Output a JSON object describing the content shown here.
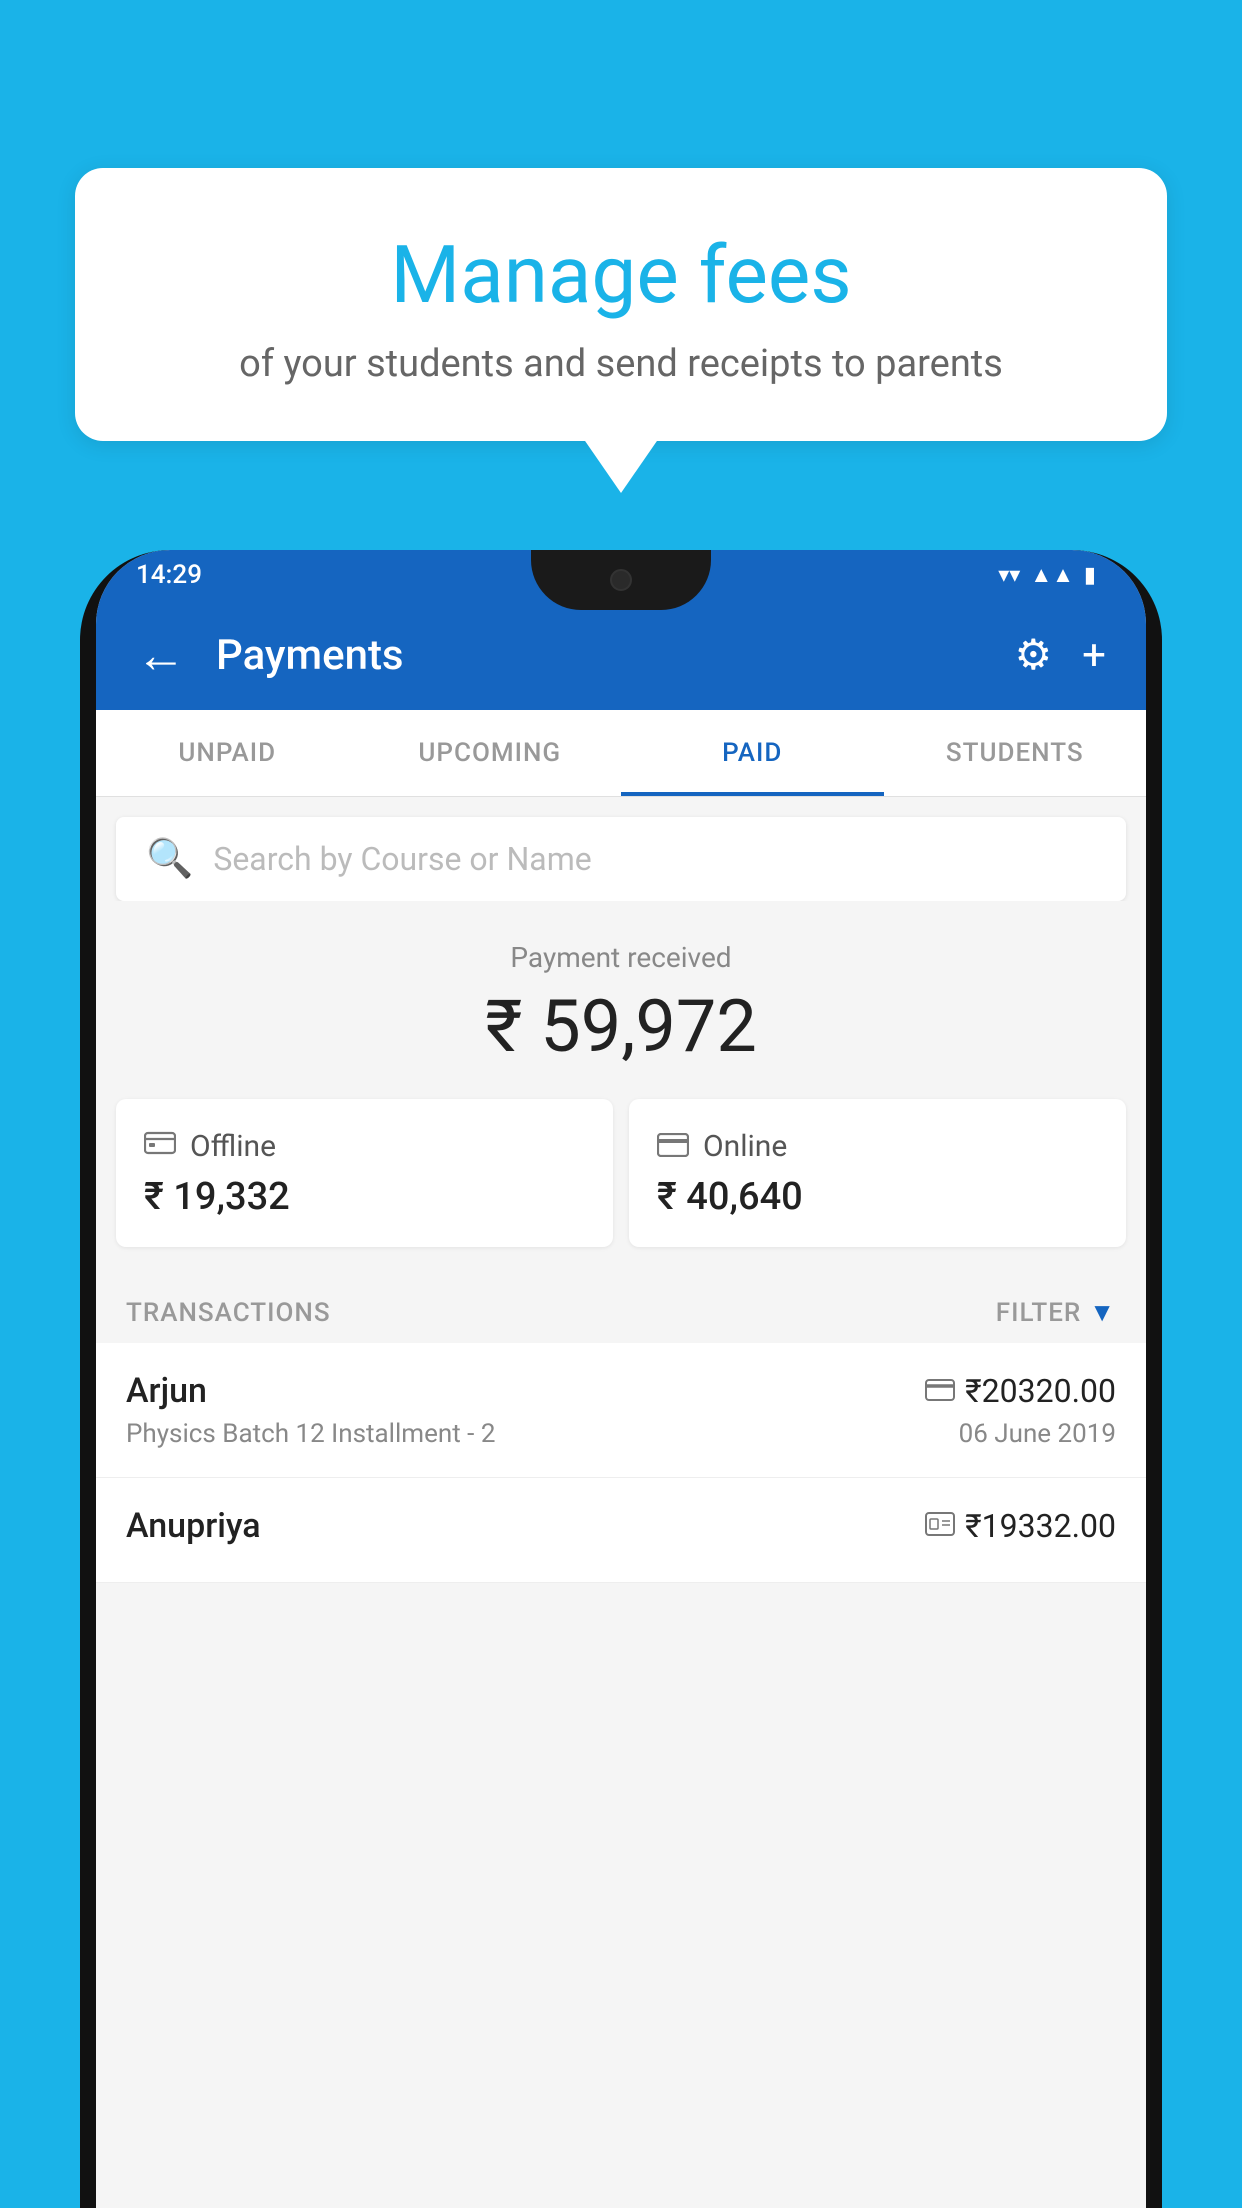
{
  "background_color": "#1ab3e8",
  "bubble": {
    "title": "Manage fees",
    "subtitle": "of your students and send receipts to parents"
  },
  "phone": {
    "status_bar": {
      "time": "14:29",
      "wifi": "▼",
      "signal": "▲",
      "battery": "▮"
    },
    "app_bar": {
      "title": "Payments",
      "back_label": "←",
      "settings_label": "⚙",
      "add_label": "+"
    },
    "tabs": [
      {
        "label": "UNPAID",
        "active": false
      },
      {
        "label": "UPCOMING",
        "active": false
      },
      {
        "label": "PAID",
        "active": true
      },
      {
        "label": "STUDENTS",
        "active": false
      }
    ],
    "search": {
      "placeholder": "Search by Course or Name"
    },
    "payment_received": {
      "label": "Payment received",
      "amount": "₹ 59,972"
    },
    "payment_cards": [
      {
        "icon": "₹",
        "label": "Offline",
        "amount": "₹ 19,332"
      },
      {
        "icon": "💳",
        "label": "Online",
        "amount": "₹ 40,640"
      }
    ],
    "transactions_label": "TRANSACTIONS",
    "filter_label": "FILTER",
    "transactions": [
      {
        "name": "Arjun",
        "payment_icon": "card",
        "amount": "₹20320.00",
        "detail": "Physics Batch 12 Installment - 2",
        "date": "06 June 2019"
      },
      {
        "name": "Anupriya",
        "payment_icon": "cash",
        "amount": "₹19332.00",
        "detail": "",
        "date": ""
      }
    ]
  }
}
